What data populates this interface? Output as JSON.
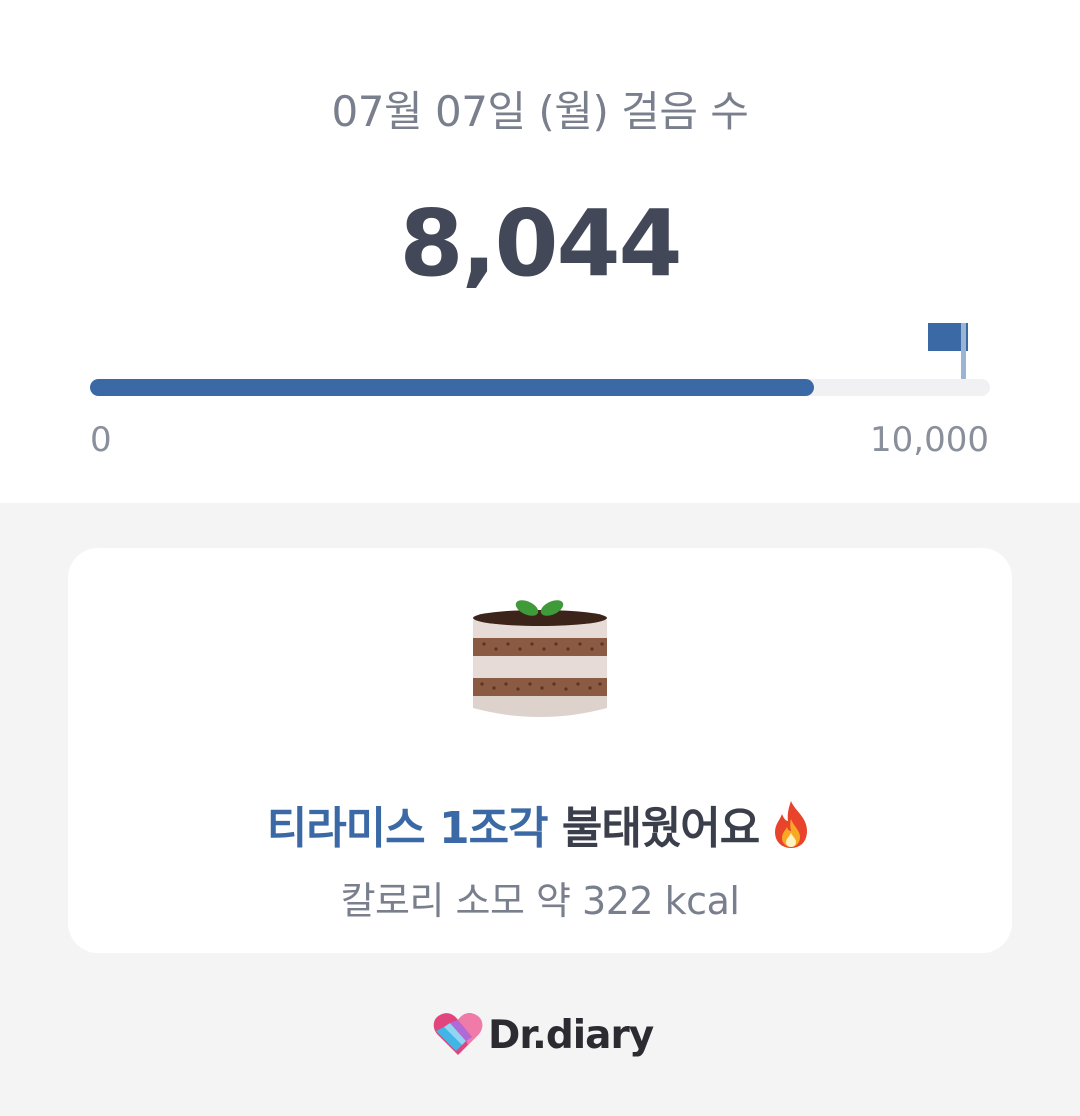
{
  "header": {
    "date_title": "07월 07일 (월) 걸음 수",
    "step_count": "8,044"
  },
  "progress": {
    "fraction": 0.8044,
    "min_label": "0",
    "max_label": "10,000",
    "fill_color": "#3a69a6",
    "track_color": "#f1f1f3"
  },
  "card": {
    "image_icon": "tiramisu-cake",
    "food_text": "티라미스 1조각",
    "burn_text": " 불태웠어요",
    "fire_icon": "fire-emoji",
    "calorie_text": "칼로리 소모 약 322 kcal"
  },
  "brand": {
    "logo_icon": "heart-logo",
    "name": "Dr.diary"
  },
  "colors": {
    "accent": "#3a69a6",
    "background": "#f4f4f4",
    "card": "#ffffff"
  }
}
